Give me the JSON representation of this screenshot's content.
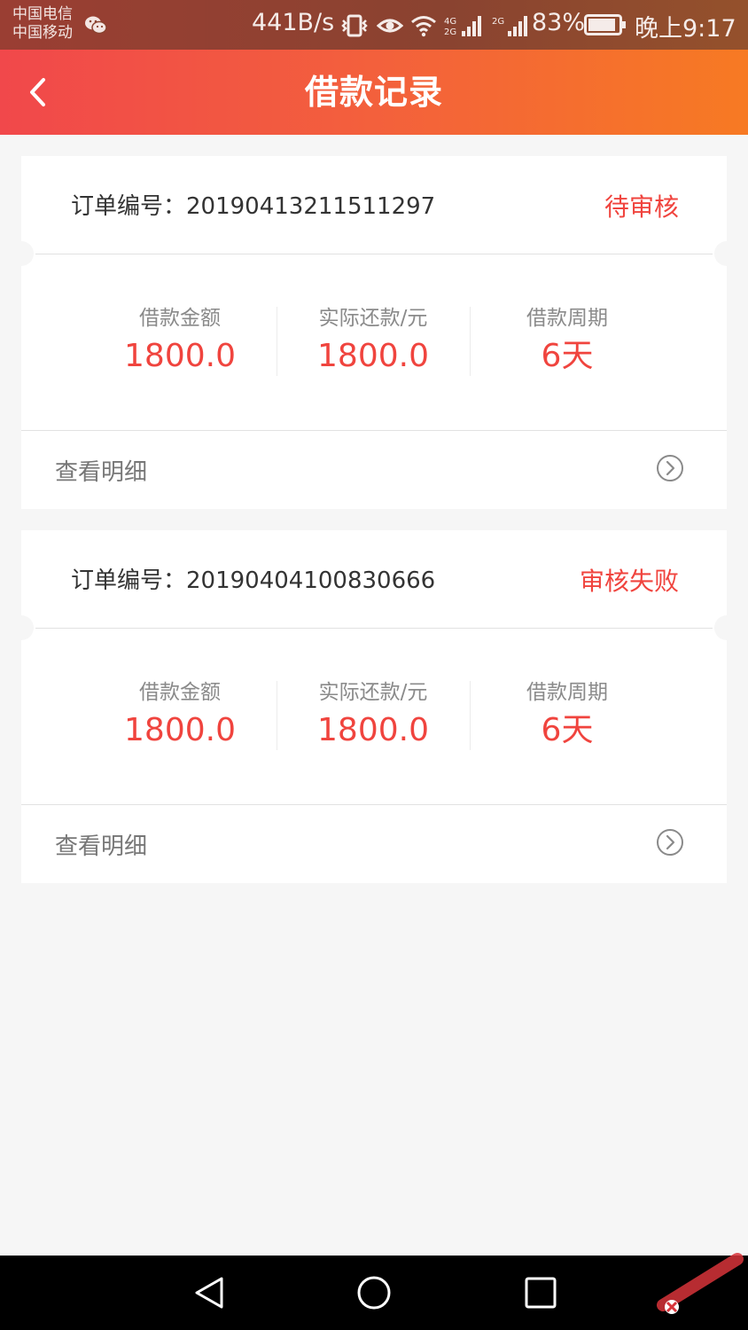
{
  "status_bar": {
    "carrier_1": "中国电信",
    "carrier_2": "中国移动",
    "net_speed": "441B/s",
    "battery_percent": "83%",
    "time": "晚上9:17",
    "icons": [
      "wechat-icon",
      "vibrate-icon",
      "eye-icon",
      "wifi-icon",
      "signal-4g-icon",
      "signal-2g-icon",
      "battery-icon"
    ]
  },
  "header": {
    "title": "借款记录",
    "back_icon": "chevron-left-icon",
    "colors": {
      "gradient_start": "#f1484b",
      "gradient_end": "#f77a23"
    }
  },
  "records": [
    {
      "order_label": "订单编号：20190413211511297",
      "status": "待审核",
      "stats": [
        {
          "label": "借款金额",
          "value": "1800.0"
        },
        {
          "label": "实际还款/元",
          "value": "1800.0"
        },
        {
          "label": "借款周期",
          "value": "6天"
        }
      ],
      "detail_label": "查看明细"
    },
    {
      "order_label": "订单编号：20190404100830666",
      "status": "审核失败",
      "stats": [
        {
          "label": "借款金额",
          "value": "1800.0"
        },
        {
          "label": "实际还款/元",
          "value": "1800.0"
        },
        {
          "label": "借款周期",
          "value": "6天"
        }
      ],
      "detail_label": "查看明细"
    }
  ],
  "accent_color": "#f0443e",
  "nav_bar": {
    "icons": [
      "nav-back-icon",
      "nav-home-icon",
      "nav-recent-icon"
    ]
  }
}
